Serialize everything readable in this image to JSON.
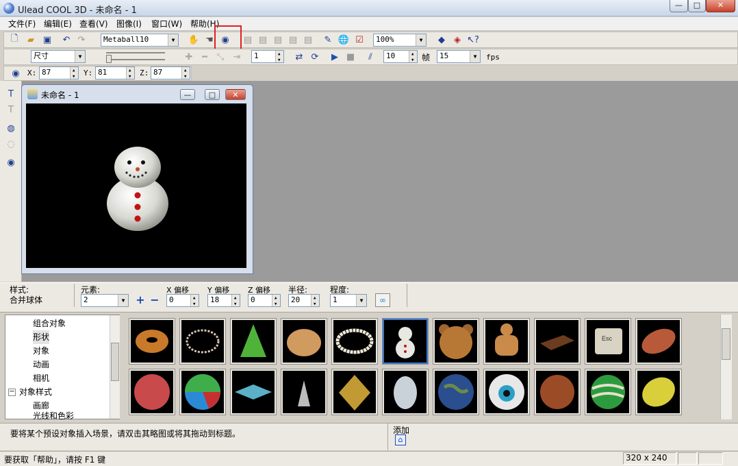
{
  "window": {
    "title": "Ulead COOL 3D - 未命名 - 1",
    "min": "—",
    "max": "□",
    "close": "✕"
  },
  "menu": [
    "文件(F)",
    "编辑(E)",
    "查看(V)",
    "图像(I)",
    "窗口(W)",
    "帮助(H)"
  ],
  "toolbar1": {
    "object_select": "Metaball10",
    "zoom": "100%"
  },
  "toolbar2": {
    "mode_select": "尺寸",
    "frame_value": "1",
    "speed_value": "10",
    "frames_label": "帧",
    "fps_value": "15",
    "fps_label": "fps"
  },
  "coord": {
    "x_label": "X:",
    "x": "87",
    "y_label": "Y:",
    "y": "81",
    "z_label": "Z:",
    "z": "87"
  },
  "child": {
    "title": "未命名 - 1"
  },
  "attr": {
    "style_label": "样式:",
    "style_value": "合并球体",
    "element_label": "元素:",
    "element_value": "2",
    "xoff_label": "X 偏移",
    "xoff": "0",
    "yoff_label": "Y 偏移",
    "yoff": "18",
    "zoff_label": "Z 偏移",
    "zoff": "0",
    "radius_label": "半径:",
    "radius": "20",
    "degree_label": "程度:",
    "degree": "1",
    "plus": "+",
    "minus": "−"
  },
  "tree": {
    "items": [
      "组合对象",
      "形状",
      "对象",
      "动画",
      "相机",
      "对象样式",
      "画廊",
      "光线和色彩"
    ]
  },
  "thumbnails": [
    "donut",
    "ring",
    "cone-tree",
    "swirl",
    "pearl-ring",
    "snowman",
    "bear",
    "gingerbread",
    "chocolate",
    "esc-key",
    "football",
    "basketball",
    "beach-ball",
    "spinning-top",
    "spike-cone",
    "pyramid-face",
    "egg",
    "earth",
    "eyeball",
    "cookie",
    "melon",
    "lemon"
  ],
  "status": {
    "hint": "要将某个预设对象插入场景，请双击其略图或将其拖动到标题。",
    "add_label": "添加",
    "help": "要获取「帮助」，请按 F1 键",
    "size": "320 x 240"
  },
  "colors": {
    "accent": "#e02020",
    "selection": "#3b79d6",
    "workspace": "#9b9b9b"
  }
}
